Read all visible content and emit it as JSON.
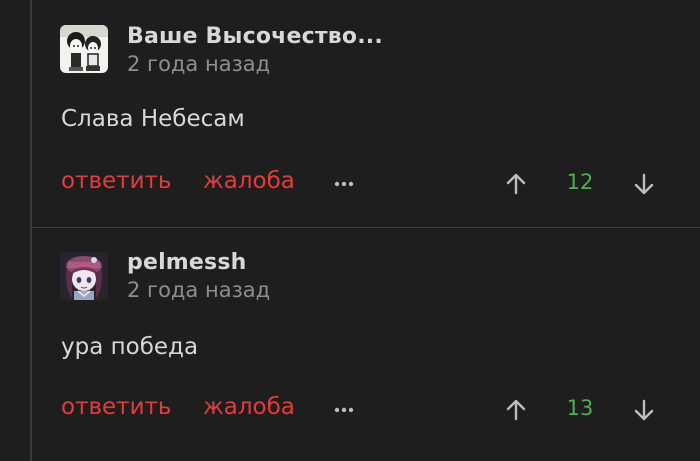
{
  "comments": [
    {
      "username": "Ваше Высочество...",
      "time": "2 года назад",
      "text": "Слава Небесам",
      "actions": {
        "reply_label": "ответить",
        "report_label": "жалоба",
        "more_icon": "ellipsis-icon",
        "upvote_icon": "arrow-up-icon",
        "downvote_icon": "arrow-down-icon",
        "score": "12"
      }
    },
    {
      "username": "pelmessh",
      "time": "2 года назад",
      "text": "ура победа",
      "actions": {
        "reply_label": "ответить",
        "report_label": "жалоба",
        "more_icon": "ellipsis-icon",
        "upvote_icon": "arrow-up-icon",
        "downvote_icon": "arrow-down-icon",
        "score": "13"
      }
    }
  ],
  "colors": {
    "background": "#1e1e1e",
    "action": "#e53b3b",
    "score": "#4caf50",
    "text": "#d8d8d8",
    "muted": "#8e8e8e"
  }
}
